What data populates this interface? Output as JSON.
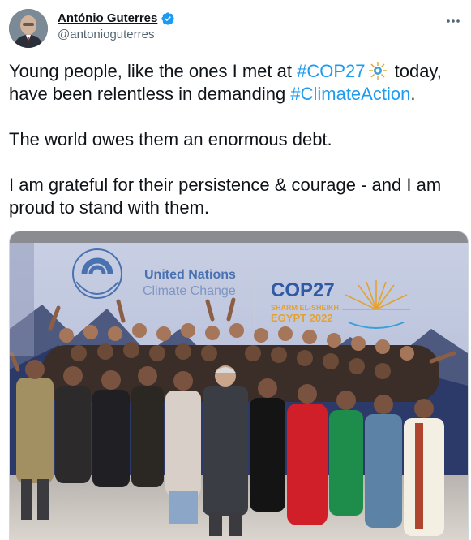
{
  "author": {
    "display_name": "António Guterres",
    "handle": "@antonioguterres",
    "verified": true
  },
  "tweet": {
    "line1_before": "Young people, like the ones I met at ",
    "hashtag1": "#COP27",
    "line1_after": " today,",
    "line2_before": "have been relentless in demanding ",
    "hashtag2": "#ClimateAction",
    "line2_after": ".",
    "paragraph2": "The world owes them an enormous debt.",
    "paragraph3": "I am grateful for their persistence & courage - and I am proud to stand with them."
  },
  "media": {
    "banner_org_line1": "United Nations",
    "banner_org_line2": "Climate Change",
    "banner_event": "COP27",
    "banner_location": "SHARM EL-SHEIKH",
    "banner_country_year": "EGYPT 2022"
  },
  "colors": {
    "hashtag": "#1d9bf0",
    "verified_badge": "#1d9bf0",
    "un_blue": "#4a72b0",
    "cop_gold": "#e3a230"
  },
  "icons": {
    "verified": "verified-badge-icon",
    "more": "more-options-icon",
    "cop27_emoji": "cop27-sun-emoji-icon"
  }
}
